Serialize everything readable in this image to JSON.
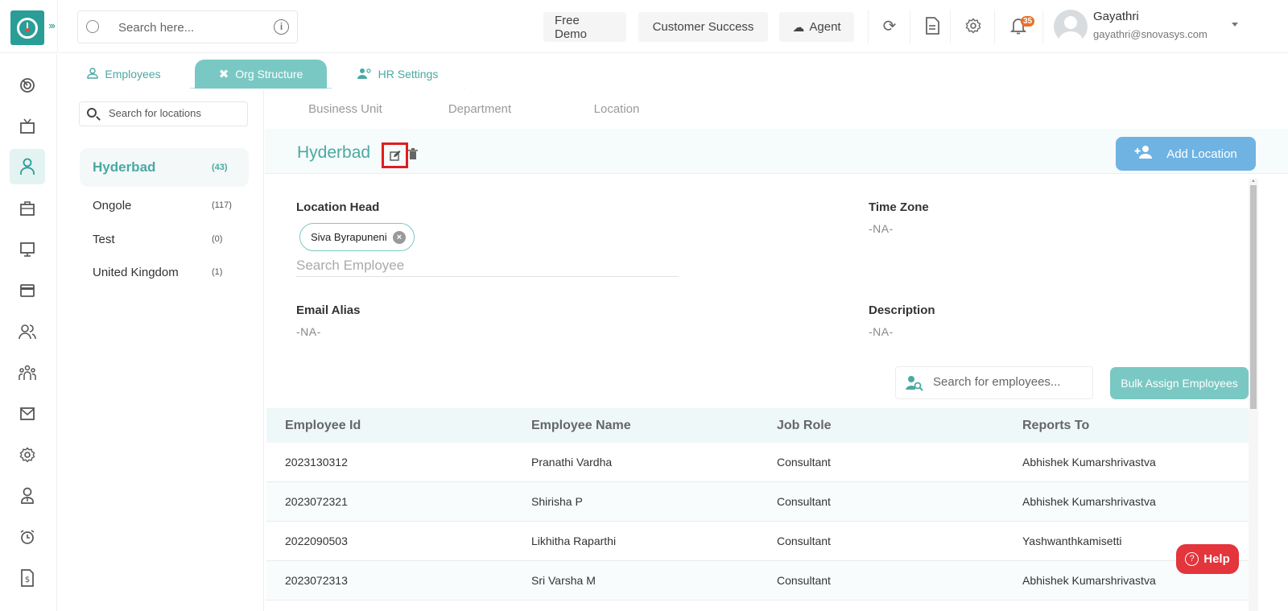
{
  "topbar": {
    "search_placeholder": "Search here...",
    "buttons": {
      "free_demo": "Free Demo",
      "customer_success": "Customer Success",
      "agent": "Agent"
    },
    "notification_count": "35",
    "user": {
      "name": "Gayathri",
      "email": "gayathri@snovasys.com"
    }
  },
  "rail": {
    "items": [
      {
        "icon": "dashboard-icon"
      },
      {
        "icon": "tv-icon"
      },
      {
        "icon": "user-icon",
        "active": true
      },
      {
        "icon": "briefcase-icon"
      },
      {
        "icon": "monitor-icon"
      },
      {
        "icon": "card-icon"
      },
      {
        "icon": "users-icon"
      },
      {
        "icon": "team-icon"
      },
      {
        "icon": "mail-icon"
      },
      {
        "icon": "settings-icon"
      },
      {
        "icon": "employee-icon"
      },
      {
        "icon": "alarm-icon"
      },
      {
        "icon": "invoice-icon"
      }
    ]
  },
  "module_tabs": [
    {
      "label": "Employees",
      "active": false
    },
    {
      "label": "Org Structure",
      "active": true
    },
    {
      "label": "HR Settings",
      "active": false
    }
  ],
  "locations": {
    "search_placeholder": "Search for locations",
    "items": [
      {
        "name": "Hyderbad",
        "count": "(43)",
        "active": true
      },
      {
        "name": "Ongole",
        "count": "(117)",
        "active": false
      },
      {
        "name": "Test",
        "count": "(0)",
        "active": false
      },
      {
        "name": "United Kingdom",
        "count": "(1)",
        "active": false
      }
    ]
  },
  "sub_tabs": [
    {
      "label": "Business Unit",
      "active": false
    },
    {
      "label": "Department",
      "active": false
    },
    {
      "label": "Location",
      "active": true
    }
  ],
  "detail": {
    "title": "Hyderbad",
    "add_location_label": "Add Location",
    "location_head_label": "Location Head",
    "location_head_chip": "Siva Byrapuneni",
    "search_employee_placeholder": "Search Employee",
    "time_zone_label": "Time Zone",
    "time_zone_value": "-NA-",
    "email_alias_label": "Email Alias",
    "email_alias_value": "-NA-",
    "description_label": "Description",
    "description_value": "-NA-"
  },
  "table": {
    "search_placeholder": "Search for employees...",
    "bulk_assign_label": "Bulk Assign Employees",
    "columns": [
      "Employee Id",
      "Employee Name",
      "Job Role",
      "Reports To"
    ],
    "rows": [
      [
        "2023130312",
        "Pranathi Vardha",
        "Consultant",
        "Abhishek Kumarshrivastva"
      ],
      [
        "2023072321",
        "Shirisha P",
        "Consultant",
        "Abhishek Kumarshrivastva"
      ],
      [
        "2022090503",
        "Likhitha Raparthi",
        "Consultant",
        "Yashwanthkamisetti"
      ],
      [
        "2023072313",
        "Sri Varsha M",
        "Consultant",
        "Abhishek Kumarshrivastva"
      ]
    ]
  },
  "help_label": "Help",
  "colors": {
    "brand_teal": "#2a9d96",
    "accent_teal": "#7ac8c3",
    "add_button_blue": "#6fb3e3",
    "help_red": "#e4343c",
    "badge_orange": "#e8712b",
    "highlight_red": "#e11d1d"
  }
}
